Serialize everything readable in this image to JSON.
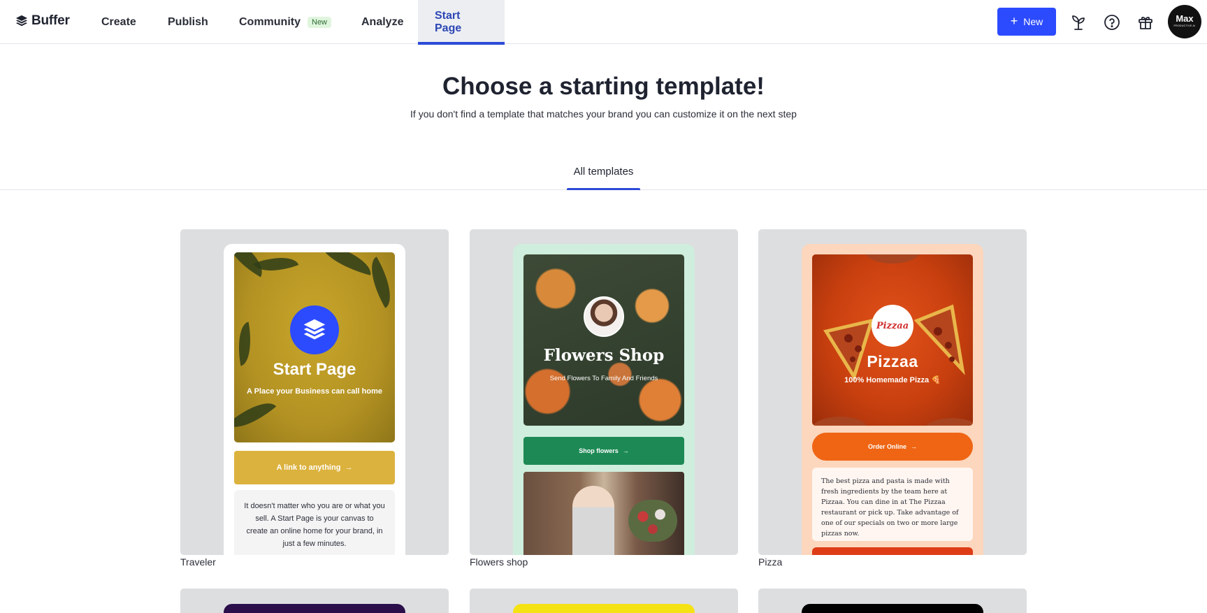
{
  "nav": {
    "logo_text": "Buffer",
    "items": [
      {
        "label": "Create"
      },
      {
        "label": "Publish"
      },
      {
        "label": "Community",
        "badge": "New"
      },
      {
        "label": "Analyze"
      },
      {
        "label": "Start Page",
        "active": true
      }
    ],
    "new_button_label": "New",
    "icons": [
      "sprout-icon",
      "help-icon",
      "gift-icon"
    ],
    "avatar": {
      "name": "Max",
      "subtitle": "PRODUCTIVE AI"
    }
  },
  "header": {
    "title": "Choose a starting template!",
    "subtitle": "If you don't find a template that matches your brand you can customize it on the next step"
  },
  "tabs": [
    {
      "label": "All templates",
      "active": true
    }
  ],
  "templates": [
    {
      "label": "Traveler",
      "preview": {
        "title": "Start Page",
        "subtitle": "A Place your Business can call home",
        "cta": "A link to anything",
        "text": "It doesn't matter who you are or what you sell. A Start Page is your canvas to create an online home for your brand, in just a few minutes."
      }
    },
    {
      "label": "Flowers shop",
      "preview": {
        "title": "Flowers Shop",
        "subtitle": "Send Flowers To Family And Friends",
        "cta": "Shop flowers"
      }
    },
    {
      "label": "Pizza",
      "preview": {
        "logo_text": "Pizzaa",
        "title": "Pizzaa",
        "subtitle": "100% Homemade Pizza 🍕",
        "cta": "Order Online",
        "text": "The best pizza and pasta is made with fresh ingredients by the team here at Pizzaa. You can dine in at The Pizzaa restaurant or pick up. Take advantage of one of our specials on two or more large pizzas now."
      }
    }
  ],
  "colors": {
    "accent": "#2c4bff",
    "active_nav_text": "#2c46b4",
    "card_bg": "#dddee0",
    "traveler_gold": "#dcb23e",
    "flowers_green": "#1d8a55",
    "pizza_orange": "#ef6514",
    "row2_card1_accent": "#2a0f4a",
    "row2_card2_accent": "#f5e214",
    "row2_card3_accent": "#000000"
  }
}
